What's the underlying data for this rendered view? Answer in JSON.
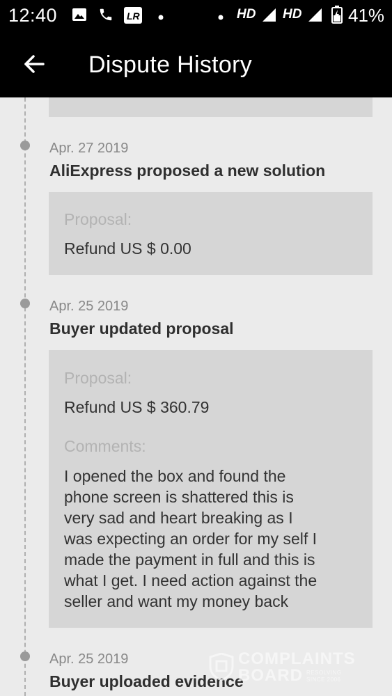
{
  "status_bar": {
    "time": "12:40",
    "network_1": "HD",
    "network_2": "HD",
    "battery": "41%"
  },
  "app_bar": {
    "title": "Dispute History",
    "back_icon": "arrow-left-icon"
  },
  "entries": [
    {
      "date": "Apr. 27 2019",
      "title": "AliExpress proposed a new solution",
      "proposal_label": "Proposal:",
      "proposal_value": "Refund US $ 0.00"
    },
    {
      "date": "Apr. 25 2019",
      "title": "Buyer updated proposal",
      "proposal_label": "Proposal:",
      "proposal_value": "Refund US $ 360.79",
      "comments_label": "Comments:",
      "comments_lines": [
        "I opened the box and found the",
        "phone screen is shattered this is",
        "very sad and heart breaking as I",
        "was expecting an order for my self I",
        "made the payment in full and this is",
        "what I get. I need action against the",
        "seller and want my money back"
      ]
    },
    {
      "date": "Apr. 25 2019",
      "title": "Buyer uploaded evidence"
    }
  ],
  "watermark": {
    "line1": "COMPLAINTS",
    "line2": "BOARD",
    "tagline": "RESOLVING SINCE 2006"
  },
  "colors": {
    "bar_background": "#000000",
    "page_background": "#ebebeb",
    "card_background": "#d6d6d6"
  }
}
